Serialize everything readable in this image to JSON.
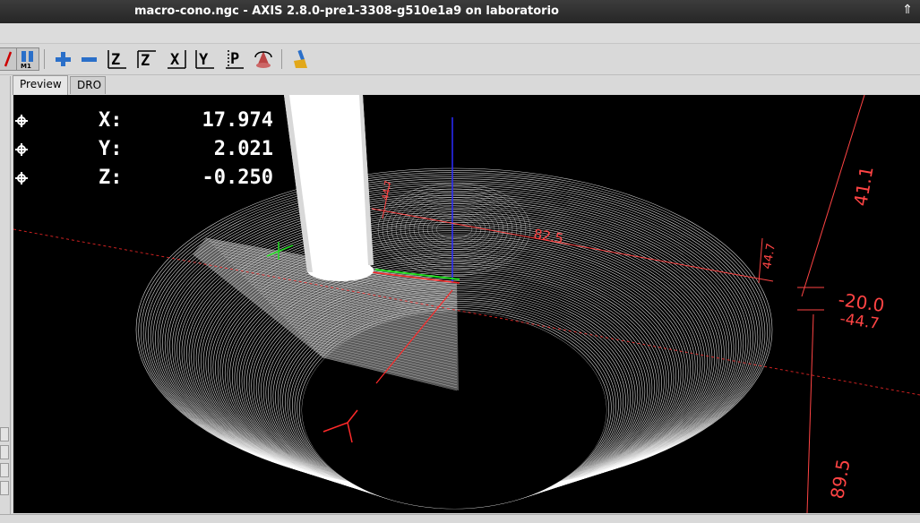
{
  "window": {
    "title": "macro-cono.ngc - AXIS 2.8.0-pre1-3308-g510e1a9 on laboratorio",
    "maximize_glyph": "⇑"
  },
  "toolbar": {
    "buttons": [
      {
        "name": "run-mark-icon",
        "glyph": "/"
      },
      {
        "name": "optional-stop-icon",
        "glyph": "M1"
      },
      {
        "name": "zoom-in-icon",
        "glyph": "+"
      },
      {
        "name": "zoom-out-icon",
        "glyph": "−"
      },
      {
        "name": "view-z-icon",
        "glyph": "Z"
      },
      {
        "name": "view-z2-icon",
        "glyph": "Z"
      },
      {
        "name": "view-x-icon",
        "glyph": "X"
      },
      {
        "name": "view-y-icon",
        "glyph": "Y"
      },
      {
        "name": "view-p-icon",
        "glyph": "P"
      },
      {
        "name": "rotate-view-icon",
        "glyph": "⟳"
      },
      {
        "name": "clear-plot-icon",
        "glyph": "✎"
      }
    ]
  },
  "tabs": [
    {
      "label": "Preview",
      "active": true
    },
    {
      "label": "DRO",
      "active": false
    }
  ],
  "dro": [
    {
      "axis": "X:",
      "value": "17.974"
    },
    {
      "axis": "Y:",
      "value": "2.021"
    },
    {
      "axis": "Z:",
      "value": "-0.250"
    }
  ],
  "dimensions": {
    "x_extent": "82.5",
    "y_extent": "41.1",
    "y_extent_small": "44.7",
    "z_min": "-20.0",
    "z_min_2": "-44.7",
    "x_right": "89.5",
    "top_left": "44.7",
    "right_small": "44.7"
  },
  "colors": {
    "background": "#000000",
    "toolpath": "#ffffff",
    "axis_x": "#ff2a2a",
    "axis_y": "#22dd22",
    "axis_z": "#2a2aff",
    "extents": "#ff4444"
  }
}
